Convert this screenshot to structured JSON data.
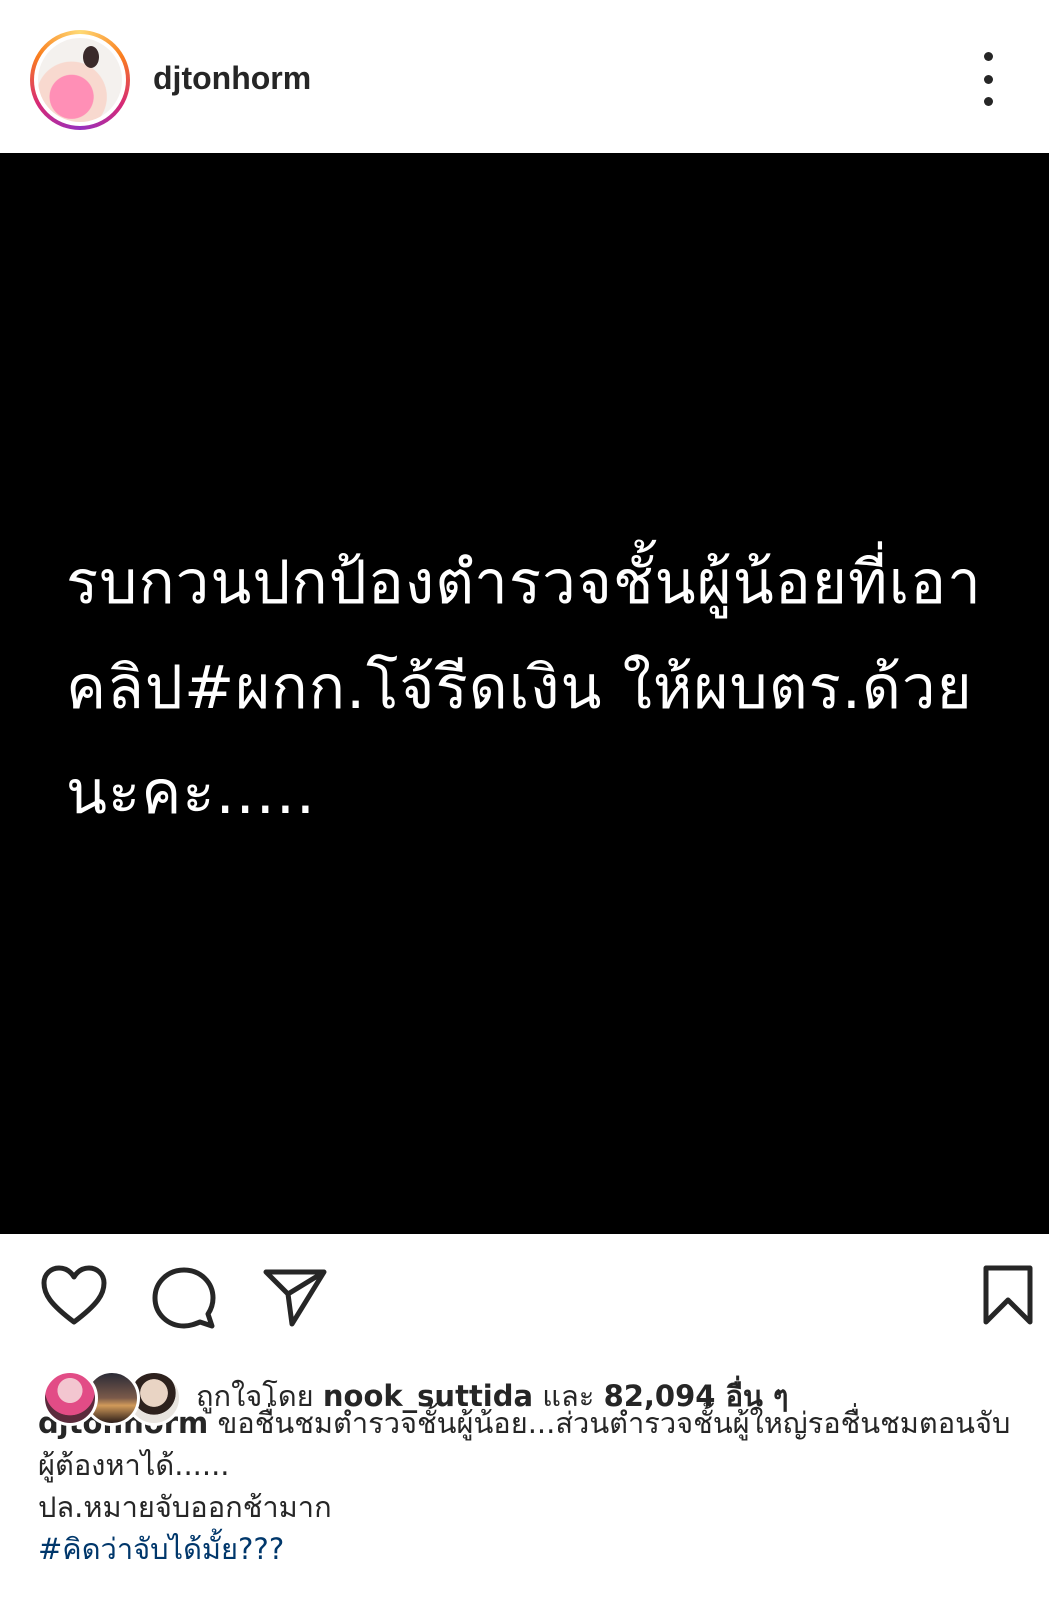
{
  "header": {
    "username": "djtonhorm",
    "avatar_icon": "profile-avatar",
    "more_icon": "more-vertical-icon"
  },
  "post": {
    "image_text_lines": [
      "รบกวนปกป้องตำรวจชั้นผู้น้อยที่เอา",
      "คลิป#ผกก.โจ้รีดเงิน ให้ผบตร.ด้วย",
      "นะคะ....."
    ],
    "background_color": "#000000",
    "text_color": "#ffffff"
  },
  "actions": {
    "like_icon": "heart-icon",
    "comment_icon": "comment-icon",
    "share_icon": "send-icon",
    "save_icon": "bookmark-icon"
  },
  "likes": {
    "prefix": "ถูกใจโดย ",
    "user": "nook_suttida",
    "middle": " และ ",
    "count": "82,094 อื่น ๆ"
  },
  "caption": {
    "username": "djtonhorm",
    "text_line1": " ขอชื่นชมตำรวจชั้นผู้น้อย...ส่วนตำรวจชั้นผู้ใหญ่รอชื่นชมตอนจับผู้ต้องหาได้......",
    "text_line2": "ปล.หมายจับออกช้ามาก",
    "hashtag": "#คิดว่าจับได้มั้ย",
    "hashtag_suffix": "???"
  }
}
